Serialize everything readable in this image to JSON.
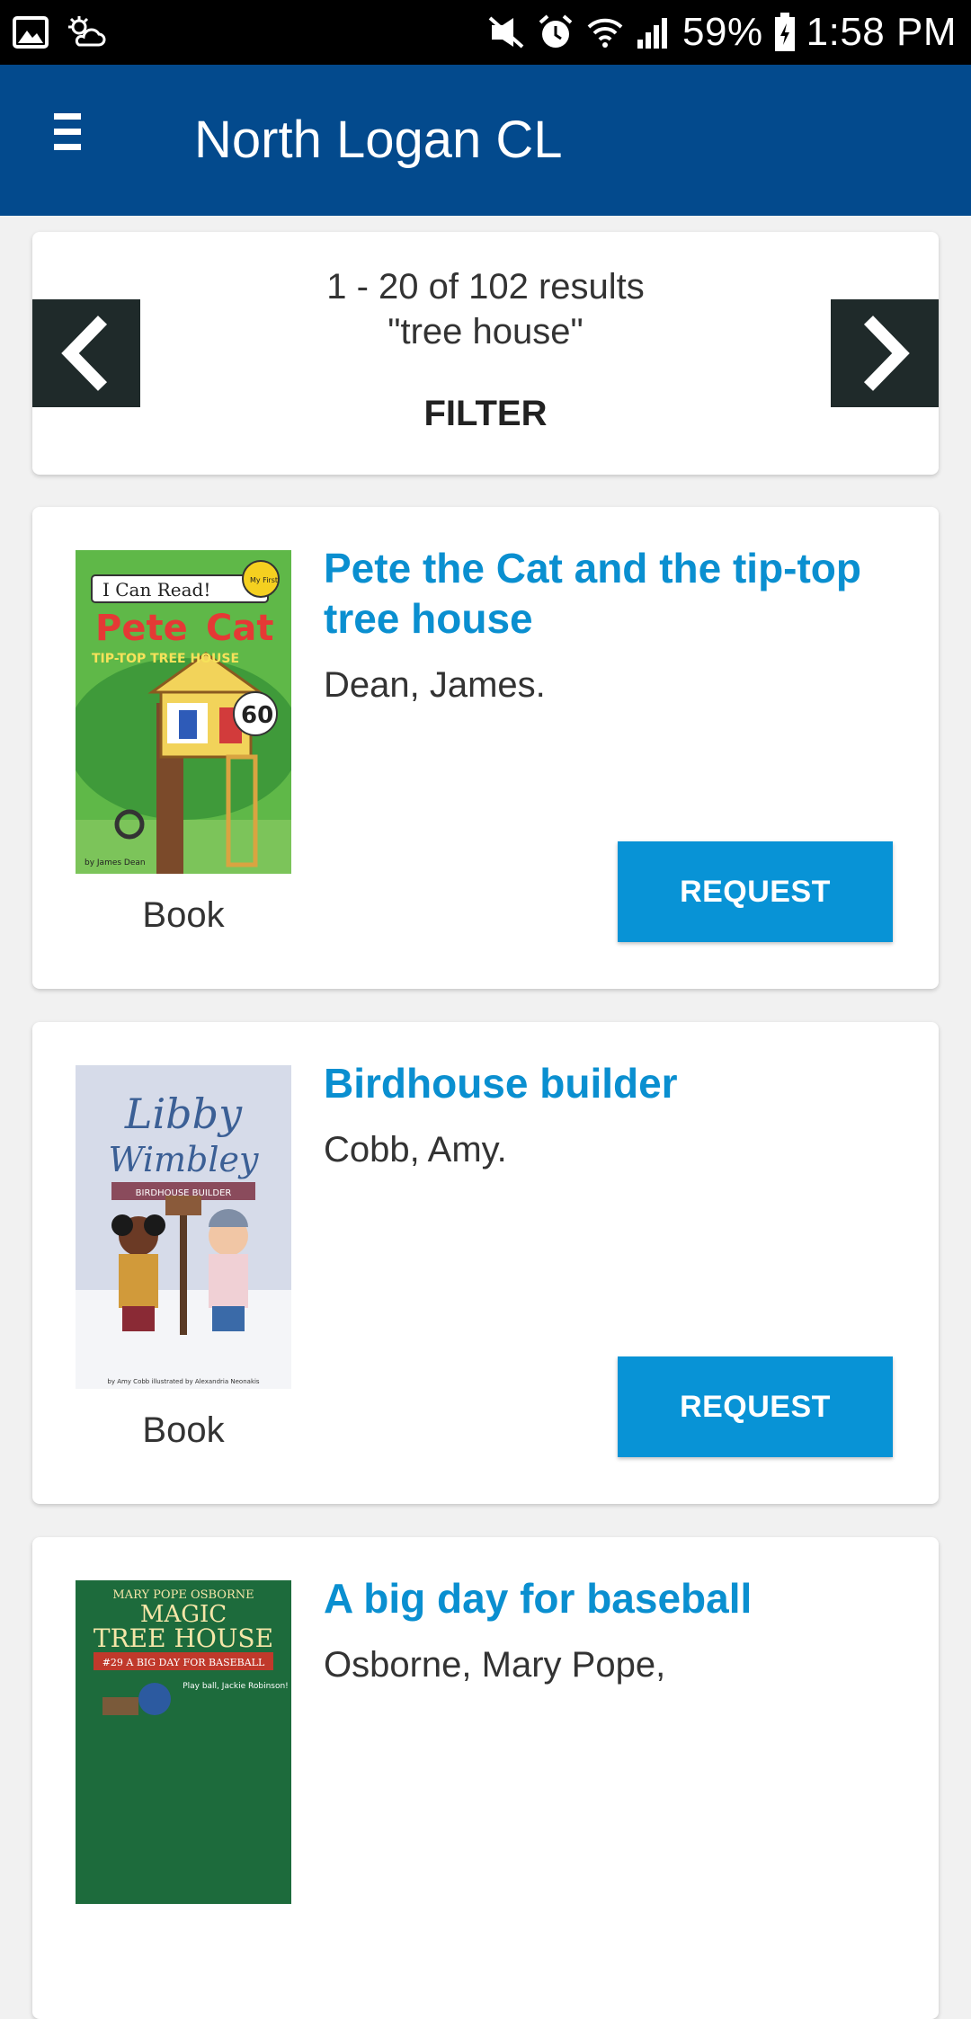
{
  "status_bar": {
    "battery": "59%",
    "time": "1:58 PM",
    "icons": [
      "image-icon",
      "weather-icon",
      "mute-icon",
      "alarm-icon",
      "wifi-icon",
      "signal-icon",
      "battery-icon"
    ]
  },
  "app_bar": {
    "title": "North Logan CL",
    "menu_icon": "hamburger-menu-icon",
    "color": "#034a8d"
  },
  "pager": {
    "summary": "1 - 20 of 102 results",
    "query": "\"tree house\"",
    "filter_label": "FILTER",
    "prev_icon": "chevron-left-icon",
    "next_icon": "chevron-right-icon"
  },
  "results": [
    {
      "title": "Pete the Cat and the tip-top tree house",
      "author": "Dean, James.",
      "format": "Book",
      "request_label": "REQUEST",
      "cover_text": {
        "series": "I Can Read!",
        "badge": "My First",
        "title_line_1": "Pete",
        "title_line_2": "Cat",
        "title_sub": "TIP-TOP TREE HOUSE",
        "anniversary": "60",
        "byline": "by James Dean"
      }
    },
    {
      "title": "Birdhouse builder",
      "author": "Cobb, Amy.",
      "format": "Book",
      "request_label": "REQUEST",
      "cover_text": {
        "title_line_1": "Libby",
        "title_line_2": "Wimbley",
        "subtitle": "BIRDHOUSE BUILDER",
        "byline": "by Amy Cobb illustrated by Alexandria Neonakis"
      }
    },
    {
      "title": "A big day for baseball",
      "author": "Osborne, Mary Pope,",
      "cover_text": {
        "author": "MARY POPE OSBORNE",
        "title_line_1": "MAGIC",
        "title_line_2": "TREE HOUSE",
        "subtitle": "#29 A BIG DAY FOR BASEBALL",
        "tagline": "Play ball, Jackie Robinson!"
      }
    }
  ],
  "colors": {
    "link_title": "#0a8fd0",
    "request_button": "#0893d6",
    "nav_button": "#1f2a2a"
  }
}
